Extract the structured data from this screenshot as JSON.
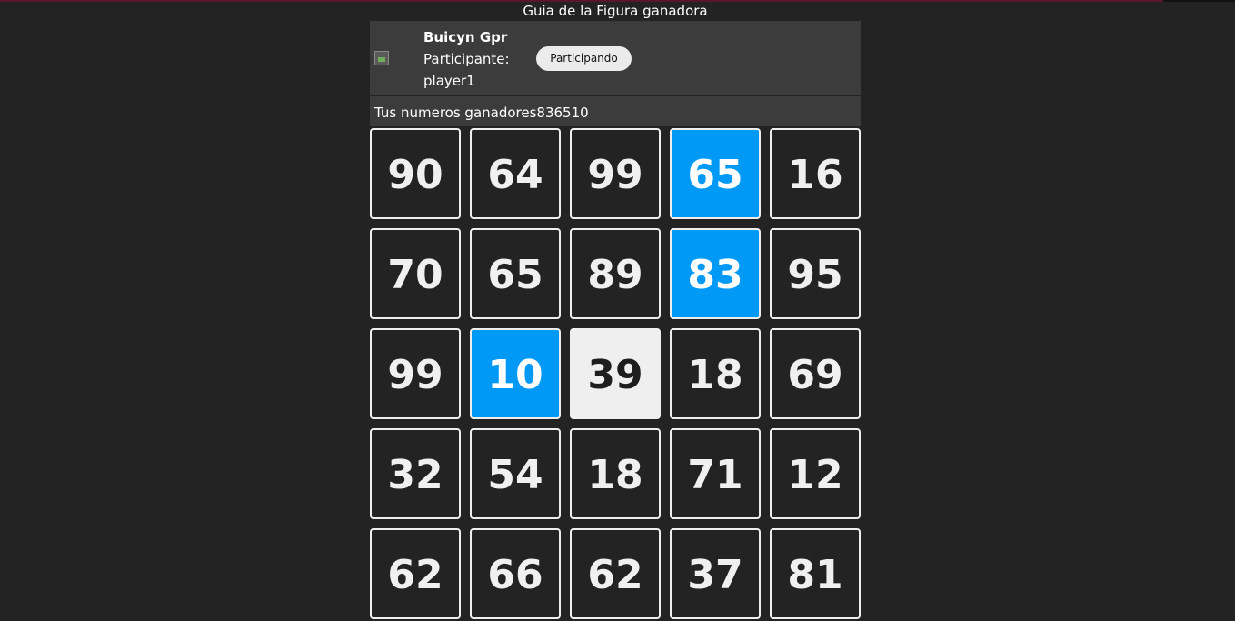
{
  "page": {
    "title": "Guia de la Figura ganadora"
  },
  "player": {
    "name": "Buicyn Gpr",
    "role_label": "Participante:",
    "id": "player1",
    "status_button": "Participando",
    "avatar_icon": "broken-image-icon"
  },
  "numbers_header": "Tus numeros ganadores836510",
  "colors": {
    "background": "#232323",
    "panel": "#3c3c3c",
    "marked": "#0099f5",
    "free": "#efefef"
  },
  "board": {
    "rows": [
      [
        {
          "value": "90",
          "state": "normal"
        },
        {
          "value": "64",
          "state": "normal"
        },
        {
          "value": "99",
          "state": "normal"
        },
        {
          "value": "65",
          "state": "marked"
        },
        {
          "value": "16",
          "state": "normal"
        }
      ],
      [
        {
          "value": "70",
          "state": "normal"
        },
        {
          "value": "65",
          "state": "normal"
        },
        {
          "value": "89",
          "state": "normal"
        },
        {
          "value": "83",
          "state": "marked"
        },
        {
          "value": "95",
          "state": "normal"
        }
      ],
      [
        {
          "value": "99",
          "state": "normal"
        },
        {
          "value": "10",
          "state": "marked"
        },
        {
          "value": "39",
          "state": "free"
        },
        {
          "value": "18",
          "state": "normal"
        },
        {
          "value": "69",
          "state": "normal"
        }
      ],
      [
        {
          "value": "32",
          "state": "normal"
        },
        {
          "value": "54",
          "state": "normal"
        },
        {
          "value": "18",
          "state": "normal"
        },
        {
          "value": "71",
          "state": "normal"
        },
        {
          "value": "12",
          "state": "normal"
        }
      ],
      [
        {
          "value": "62",
          "state": "normal"
        },
        {
          "value": "66",
          "state": "normal"
        },
        {
          "value": "62",
          "state": "normal"
        },
        {
          "value": "37",
          "state": "normal"
        },
        {
          "value": "81",
          "state": "normal"
        }
      ]
    ]
  }
}
